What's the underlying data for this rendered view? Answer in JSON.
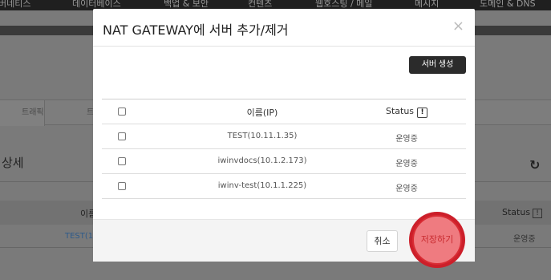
{
  "background": {
    "nav_items": [
      "버네티스",
      "데이터베이스",
      "백업 & 보안",
      "컨텐츠",
      "웹호스팅 / 메일",
      "메시지",
      "도메인 & DNS"
    ],
    "tabs": [
      "트래픽",
      "트"
    ],
    "section_title": "상세",
    "table_header_name": "이름",
    "table_header_status": "Status",
    "row_name": "TEST(1",
    "row_status": "운영중"
  },
  "modal": {
    "title": "NAT GATEWAY에 서버 추가/제거",
    "close": "×",
    "create_button": "서버 생성",
    "table": {
      "header_ip": "이름(IP)",
      "header_status": "Status",
      "info_glyph": "!",
      "rows": [
        {
          "ip": "TEST(10.11.1.35)",
          "status": "운영중"
        },
        {
          "ip": "iwinvdocs(10.1.2.173)",
          "status": "운영중"
        },
        {
          "ip": "iwinv-test(10.1.1.225)",
          "status": "운영중"
        }
      ]
    },
    "cancel_button": "취소",
    "save_button": "저장하기"
  },
  "colors": {
    "overlay": "#7a7a7a",
    "dark_button": "#2b2b2b",
    "highlight_ring": "#cc1f2a",
    "highlight_fill": "#ef7b80"
  },
  "icons": [
    "close-icon",
    "info-icon",
    "refresh-icon"
  ]
}
